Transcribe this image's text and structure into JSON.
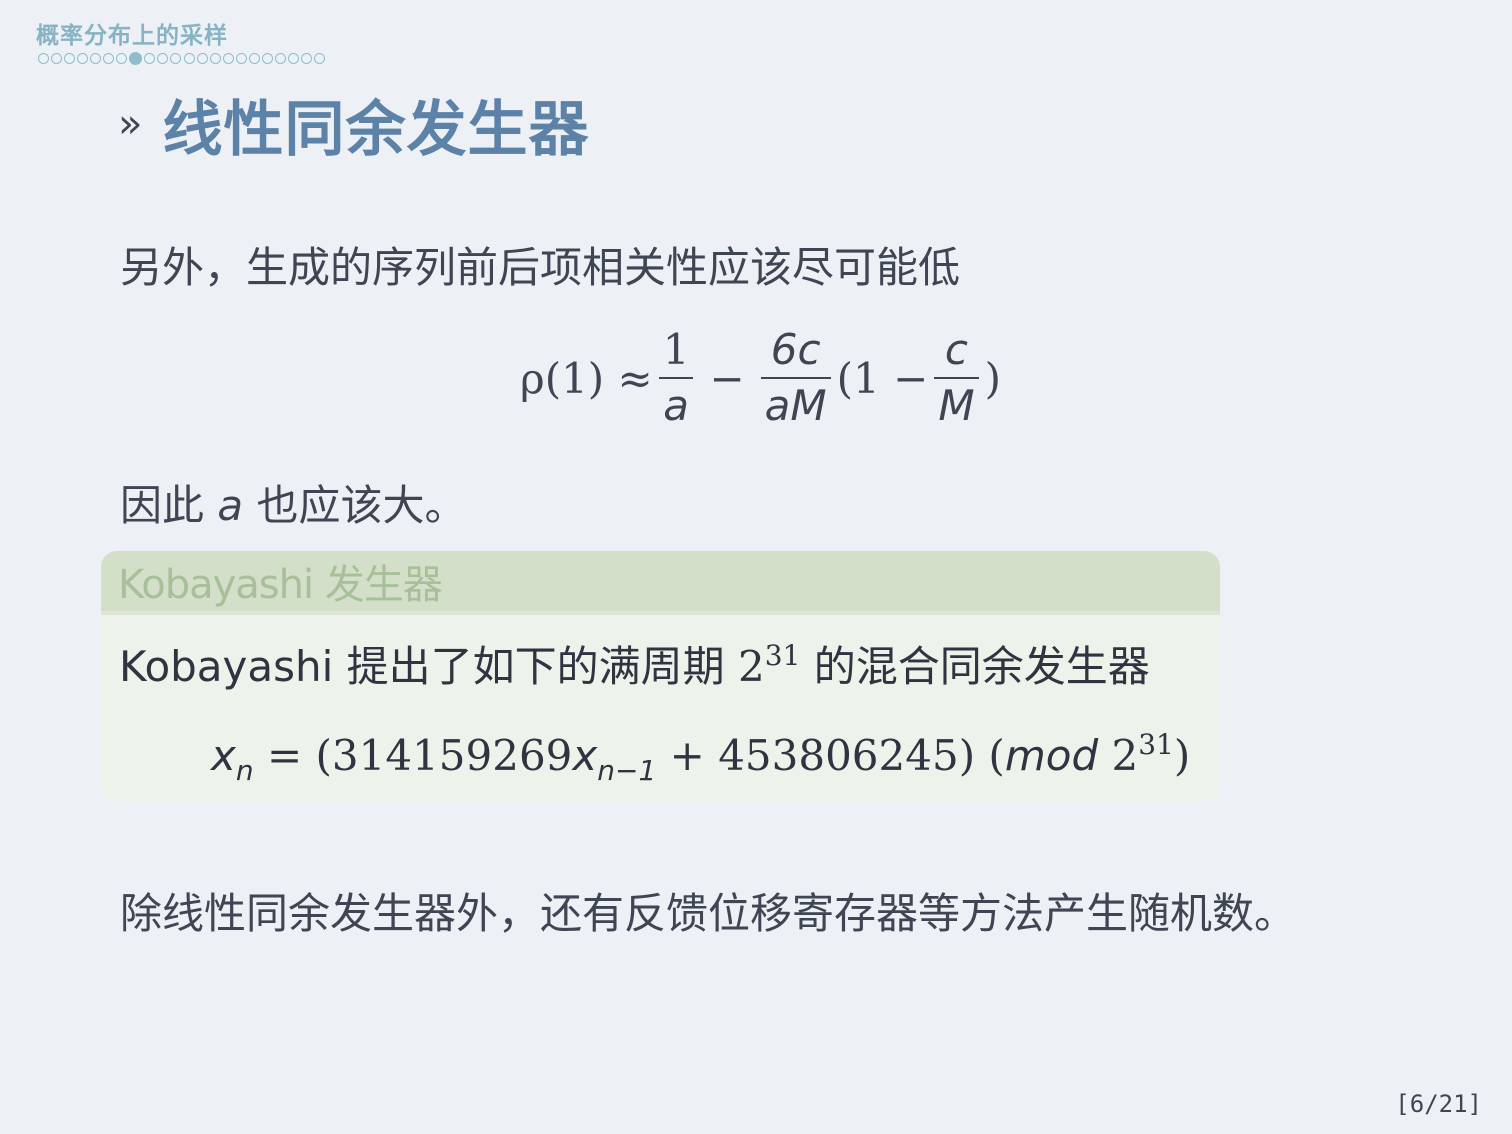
{
  "header": {
    "section_title": "概率分布上的采样",
    "nav_dots_total": 22,
    "nav_dots_active_index": 7
  },
  "frame": {
    "title_mark": "»",
    "title": "线性同余发生器"
  },
  "content": {
    "paragraph1": "另外，生成的序列前后项相关性应该尽可能低",
    "formula1": {
      "lhs": "ρ(1) ≈",
      "frac1_num": "1",
      "frac1_den": "a",
      "minus1": "−",
      "frac2_num": "6c",
      "frac2_den": "aM",
      "paren_open": "(1 −",
      "frac3_num": "c",
      "frac3_den": "M",
      "paren_close": ")"
    },
    "paragraph2_pre": "因此",
    "paragraph2_var": "a",
    "paragraph2_post": "也应该大。",
    "paragraph3": "除线性同余发生器外，还有反馈位移寄存器等方法产生随机数。"
  },
  "block": {
    "title": "Kobayashi 发生器",
    "body_pre": "Kobayashi 提出了如下的满周期",
    "body_base": "2",
    "body_exp": "31",
    "body_post": "的混合同余发生器",
    "formula": {
      "x": "x",
      "sub_n": "n",
      "eq": "= (314159269",
      "x2": "x",
      "sub_n1": "n−1",
      "plus": "+ 453806245) (",
      "mod": "mod",
      "base": "2",
      "exp": "31",
      "close": ")"
    }
  },
  "footer": {
    "page_number": "[6/21]"
  },
  "colors": {
    "background": "#edf0f5",
    "title": "#5d82a8",
    "section": "#87b3c4",
    "block_header": "#d3dfc9",
    "block_body": "#edf2ea",
    "text": "#3f4552"
  }
}
